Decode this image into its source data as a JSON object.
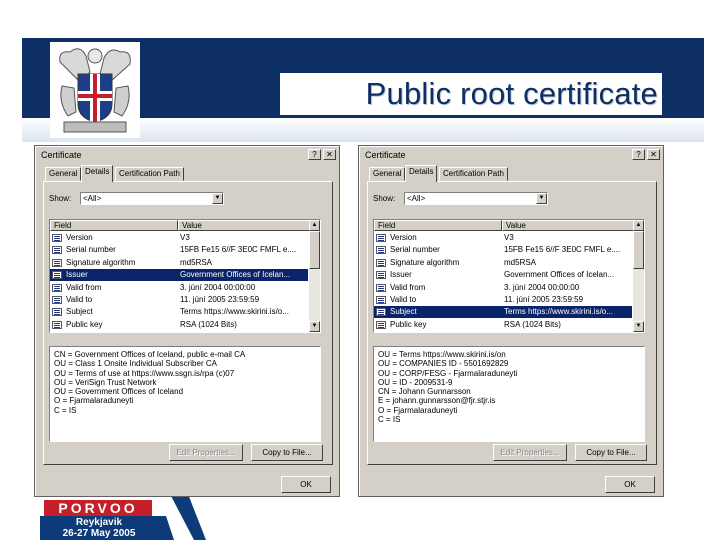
{
  "slide": {
    "title": "Public root certificate",
    "bottom_logo": {
      "line1": "PORVOO",
      "line2": "Reykjavik",
      "line3": "26-27 May 2005"
    }
  },
  "colors": {
    "navy": "#0e2f63",
    "selection": "#0a246a",
    "dialog": "#d4d0c8",
    "red": "#c5202a"
  },
  "dialogs": [
    {
      "title": "Certificate",
      "help_btn": "?",
      "close_btn": "✕",
      "tabs": [
        "General",
        "Details",
        "Certification Path"
      ],
      "active_tab": 1,
      "show_label": "Show:",
      "show_value": "<All>",
      "columns": [
        "Field",
        "Value"
      ],
      "rows": [
        {
          "field": "Version",
          "value": "V3",
          "selected": false
        },
        {
          "field": "Serial number",
          "value": "15FB Fe15 6//F 3E0C FMFL e....",
          "selected": false
        },
        {
          "field": "Signature algorithm",
          "value": "md5RSA",
          "selected": false
        },
        {
          "field": "Issuer",
          "value": "Government Offices of Icelan...",
          "selected": true
        },
        {
          "field": "Valid from",
          "value": "3. júní 2004 00:00:00",
          "selected": false
        },
        {
          "field": "Valid to",
          "value": "11. júní 2005 23:59:59",
          "selected": false
        },
        {
          "field": "Subject",
          "value": "Terms https://www.skirini.is/o...",
          "selected": false
        },
        {
          "field": "Public key",
          "value": "RSA (1024 Bits)",
          "selected": false
        }
      ],
      "detail_lines": [
        "CN = Government Offices of Iceland, public e-mail CA",
        "OU = Class 1 Onsite Individual Subscriber CA",
        "OU = Terms of use at https://www.ssgn.is/rpa (c)07",
        "OU = VeriSign Trust Network",
        "OU = Government Offices of Iceland",
        "O = Fjarmalaraduneyti",
        "C = IS"
      ],
      "edit_btn": "Edit Properties...",
      "copy_btn": "Copy to File...",
      "ok_btn": "OK"
    },
    {
      "title": "Certificate",
      "help_btn": "?",
      "close_btn": "✕",
      "tabs": [
        "General",
        "Details",
        "Certification Path"
      ],
      "active_tab": 1,
      "show_label": "Show:",
      "show_value": "<All>",
      "columns": [
        "Field",
        "Value"
      ],
      "rows": [
        {
          "field": "Version",
          "value": "V3",
          "selected": false
        },
        {
          "field": "Serial number",
          "value": "15FB Fe15 6//F 3E0C FMFL e....",
          "selected": false
        },
        {
          "field": "Signature algorithm",
          "value": "md5RSA",
          "selected": false
        },
        {
          "field": "Issuer",
          "value": "Government Offices of Icelan...",
          "selected": false
        },
        {
          "field": "Valid from",
          "value": "3. júní 2004 00:00:00",
          "selected": false
        },
        {
          "field": "Valid to",
          "value": "11. júní 2005 23:59:59",
          "selected": false
        },
        {
          "field": "Subject",
          "value": "Terms https://www.skirini.is/o...",
          "selected": true
        },
        {
          "field": "Public key",
          "value": "RSA (1024 Bits)",
          "selected": false
        }
      ],
      "detail_lines": [
        "OU = Terms https://www.skirini.is/on",
        "OU = COMPANIES ID - 5501692829",
        "OU = CORP/FESG - Fjarmalaraduneyti",
        "OU = ID - 2009531-9",
        "CN = Johann Gunnarsson",
        "E = johann.gunnarsson@fjr.stjr.is",
        "O = Fjarmalaraduneyti",
        "C = IS"
      ],
      "edit_btn": "Edit Properties...",
      "copy_btn": "Copy to File...",
      "ok_btn": "OK"
    }
  ]
}
